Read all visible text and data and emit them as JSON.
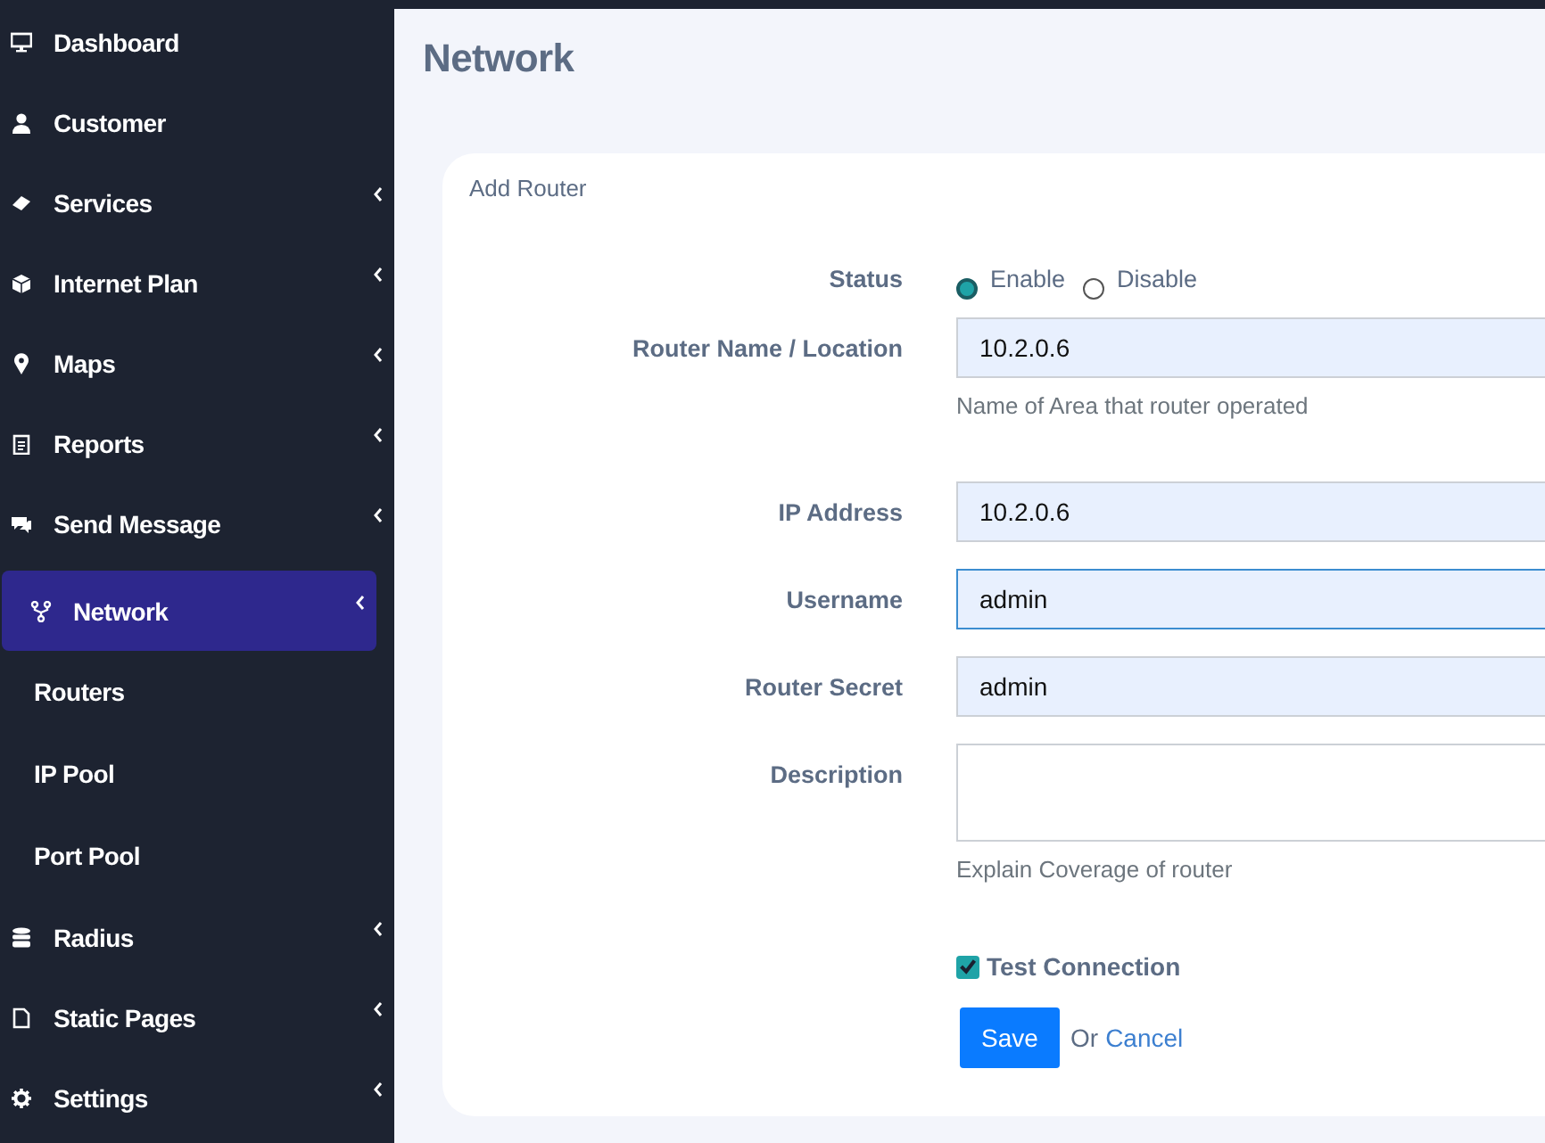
{
  "sidebar": {
    "items": [
      {
        "label": "Dashboard",
        "expandable": false,
        "selected": false
      },
      {
        "label": "Customer",
        "expandable": false,
        "selected": false
      },
      {
        "label": "Services",
        "expandable": true,
        "selected": false
      },
      {
        "label": "Internet Plan",
        "expandable": true,
        "selected": false
      },
      {
        "label": "Maps",
        "expandable": true,
        "selected": false
      },
      {
        "label": "Reports",
        "expandable": true,
        "selected": false
      },
      {
        "label": "Send Message",
        "expandable": true,
        "selected": false
      },
      {
        "label": "Network",
        "expandable": true,
        "selected": true,
        "children": [
          {
            "label": "Routers"
          },
          {
            "label": "IP Pool"
          },
          {
            "label": "Port Pool"
          }
        ]
      },
      {
        "label": "Radius",
        "expandable": true,
        "selected": false
      },
      {
        "label": "Static Pages",
        "expandable": true,
        "selected": false
      },
      {
        "label": "Settings",
        "expandable": true,
        "selected": false
      }
    ]
  },
  "page_title": "Network",
  "card": {
    "title": "Add Router",
    "status": {
      "label": "Status",
      "options": [
        {
          "label": "Enable",
          "selected": true
        },
        {
          "label": "Disable",
          "selected": false
        }
      ]
    },
    "fields": [
      {
        "label": "Router Name / Location",
        "value": "10.2.0.6",
        "focused": false,
        "help": "Name of Area that router operated"
      },
      {
        "label": "IP Address",
        "value": "10.2.0.6",
        "focused": false
      },
      {
        "label": "Username",
        "value": "admin",
        "focused": true
      },
      {
        "label": "Router Secret",
        "value": "admin",
        "focused": false
      }
    ],
    "description": {
      "label": "Description",
      "help": "Explain Coverage of router"
    },
    "test_connection": {
      "label": "Test Connection",
      "checked": true
    },
    "save_button": "Save",
    "or_text": "Or",
    "cancel_link": "Cancel"
  }
}
